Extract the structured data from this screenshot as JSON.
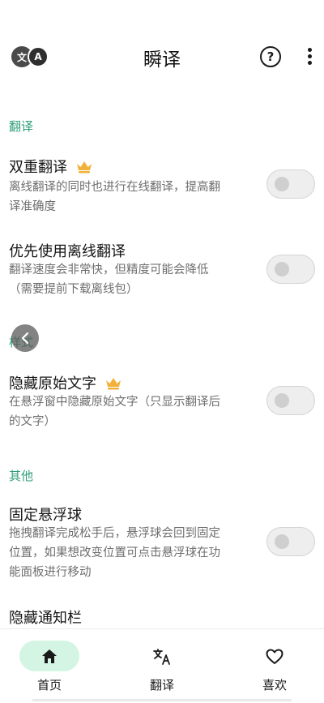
{
  "header": {
    "lang_icon_left": "文",
    "lang_icon_right": "A",
    "title": "瞬译",
    "help_icon": "question-circle-icon",
    "more_icon": "more-vertical-icon"
  },
  "sections": {
    "translate": "翻译",
    "style": "样式",
    "other": "其他"
  },
  "settings": {
    "dual": {
      "title": "双重翻译",
      "premium": true,
      "desc1": "离线翻译的同时也进行在线翻译，提高翻",
      "desc2": "译准确度",
      "enabled": false
    },
    "offline_first": {
      "title": "优先使用离线翻译",
      "desc1": "翻译速度会非常快，但精度可能会降低",
      "desc2": "（需要提前下载离线包）",
      "enabled": false
    },
    "hide_original": {
      "title": "隐藏原始文字",
      "premium": true,
      "desc1": "在悬浮窗中隐藏原始文字（只显示翻译后",
      "desc2": "的文字）",
      "enabled": false
    },
    "fix_ball": {
      "title": "固定悬浮球",
      "desc1": "拖拽翻译完成松手后，悬浮球会回到固定",
      "desc2": "位置，如果想改变位置可点击悬浮球在功",
      "desc3": "能面板进行移动",
      "enabled": false
    },
    "hide_notification": {
      "title": "隐藏通知栏"
    }
  },
  "nav": {
    "home": "首页",
    "translate": "翻译",
    "favorites": "喜欢",
    "active": "home"
  },
  "colors": {
    "accent": "#2e9e78",
    "crown": "#f2b23a",
    "nav_active_pill": "#d4f5e4"
  }
}
